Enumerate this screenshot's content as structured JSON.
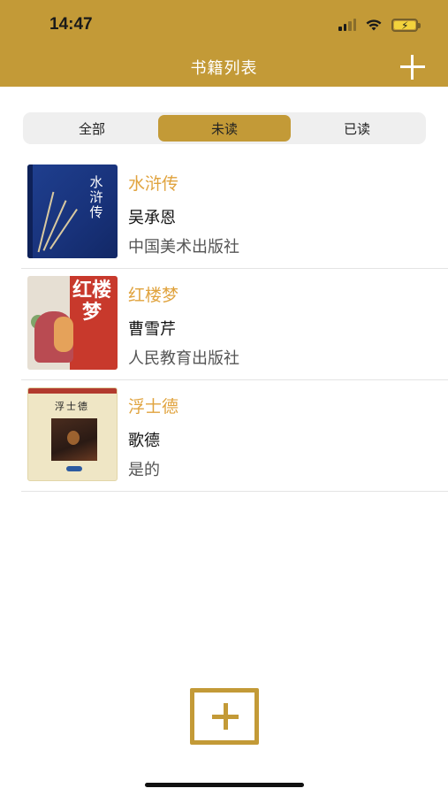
{
  "status_bar": {
    "time": "14:47"
  },
  "nav": {
    "title": "书籍列表",
    "add_icon": "plus-icon"
  },
  "segments": [
    {
      "label": "全部",
      "active": false
    },
    {
      "label": "未读",
      "active": true
    },
    {
      "label": "已读",
      "active": false
    }
  ],
  "books": [
    {
      "title": "水浒传",
      "author": "吴承恩",
      "publisher": "中国美术出版社",
      "cover_text": "水浒传"
    },
    {
      "title": "红楼梦",
      "author": "曹雪芹",
      "publisher": "人民教育出版社",
      "cover_text": "红楼梦"
    },
    {
      "title": "浮士德",
      "author": "歌德",
      "publisher": "是的",
      "cover_text": "浮士德"
    }
  ],
  "bottom_action": {
    "icon": "add-square-icon"
  },
  "colors": {
    "accent": "#c39a37",
    "title_text": "#e0a33e"
  }
}
